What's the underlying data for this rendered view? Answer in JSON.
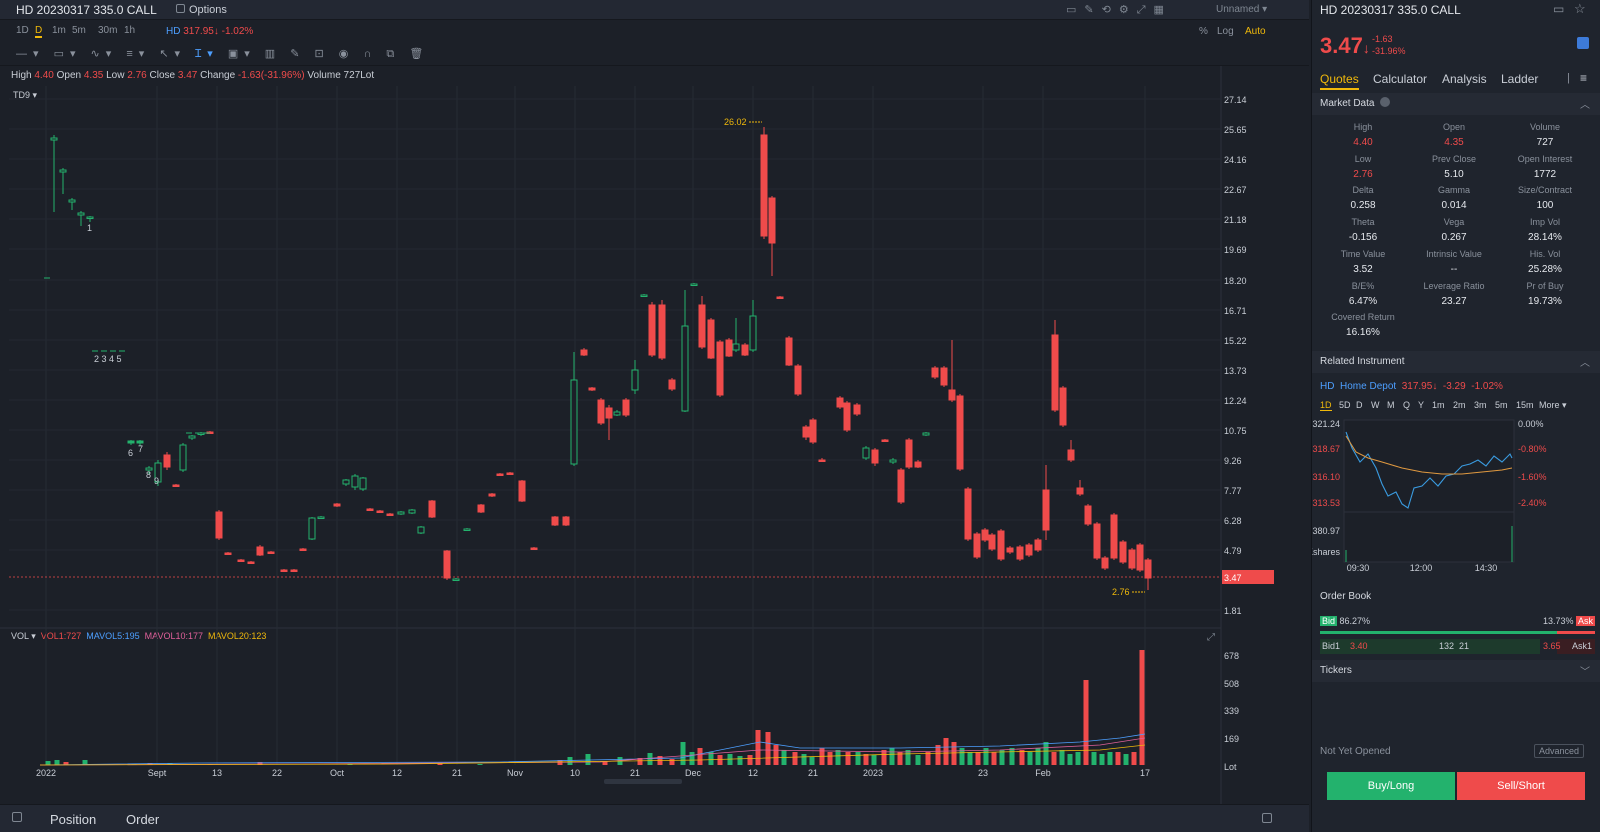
{
  "topbar": {
    "title": "HD 20230317 335.0 CALL",
    "options_label": "Options",
    "layout_label": "Unnamed"
  },
  "periods": [
    "1D",
    "D",
    "1m",
    "5m",
    "30m",
    "1h"
  ],
  "active_period": "D",
  "underlying_mini": {
    "symbol": "HD",
    "price": "317.95",
    "change": "-1.02%"
  },
  "scale_options": {
    "percent": "%",
    "log": "Log",
    "auto": "Auto"
  },
  "ohlc": {
    "high_label": "High",
    "high": "4.40",
    "open_label": "Open",
    "open": "4.35",
    "low_label": "Low",
    "low": "2.76",
    "close_label": "Close",
    "close": "3.47",
    "change_label": "Change",
    "change": "-1.63(-31.96%)",
    "volume_label": "Volume",
    "volume": "727Lot"
  },
  "indicator_label": "TD9",
  "vol_legend": {
    "vol": "VOL",
    "vol1": "VOL1:727",
    "mavol5": "MAVOL5:195",
    "mavol10": "MAVOL10:177",
    "mavol20": "MAVOL20:123"
  },
  "price_axis": [
    "27.14",
    "25.65",
    "24.16",
    "22.67",
    "21.18",
    "19.69",
    "18.20",
    "16.71",
    "15.22",
    "13.73",
    "12.24",
    "10.75",
    "9.26",
    "7.77",
    "6.28",
    "4.79",
    "3.47",
    "1.81"
  ],
  "vol_axis": [
    "678",
    "508",
    "339",
    "169",
    "Lot"
  ],
  "time_axis": [
    "2022",
    "Sept",
    "13",
    "22",
    "Oct",
    "12",
    "21",
    "Nov",
    "10",
    "21",
    "Dec",
    "12",
    "21",
    "2023",
    "23",
    "Feb",
    "17"
  ],
  "annotations": {
    "high_mark": "26.02",
    "low_mark": "2.76",
    "td_a": "1",
    "td_b": "2 3 4 5",
    "td_c": "6",
    "td_d": "7",
    "td_e": "8",
    "td_f": "9"
  },
  "colors": {
    "up": "#23b26d",
    "down": "#ef4b4b",
    "bg": "#1c2028",
    "accent": "#f0b90b"
  },
  "chart_data": {
    "type": "candlestick",
    "candles": [
      [
        54,
        140,
        138,
        212,
        135
      ],
      [
        63,
        172,
        170,
        194,
        168
      ],
      [
        72,
        202,
        200,
        210,
        198
      ],
      [
        81,
        215,
        213,
        226,
        211
      ],
      [
        90,
        218,
        217,
        222,
        216
      ],
      [
        131,
        443,
        441,
        445,
        440
      ],
      [
        140,
        443,
        441,
        446,
        440
      ],
      [
        149,
        470,
        468,
        474,
        466
      ],
      [
        158,
        482,
        463,
        486,
        460
      ],
      [
        167,
        455,
        467,
        470,
        452
      ],
      [
        176,
        485,
        486,
        487,
        484
      ],
      [
        183,
        470,
        445,
        472,
        443
      ],
      [
        192,
        438,
        436,
        440,
        435
      ],
      [
        201,
        434,
        433,
        436,
        432
      ],
      [
        210,
        432,
        432,
        433,
        431
      ],
      [
        219,
        512,
        538,
        540,
        510
      ],
      [
        228,
        553,
        554,
        555,
        552
      ],
      [
        241,
        560,
        561,
        562,
        559
      ],
      [
        251,
        562,
        563,
        564,
        561
      ],
      [
        260,
        547,
        555,
        556,
        545
      ],
      [
        271,
        552,
        553,
        554,
        551
      ],
      [
        284,
        570,
        570,
        571,
        569
      ],
      [
        294,
        570,
        570,
        571,
        569
      ],
      [
        303,
        549,
        550,
        551,
        548
      ],
      [
        312,
        539,
        518,
        540,
        517
      ],
      [
        321,
        518,
        517,
        519,
        516
      ],
      [
        337,
        504,
        506,
        507,
        503
      ],
      [
        346,
        484,
        480,
        486,
        479
      ],
      [
        355,
        487,
        476,
        490,
        474
      ],
      [
        363,
        489,
        478,
        491,
        477
      ],
      [
        370,
        509,
        510,
        511,
        508
      ],
      [
        380,
        511,
        512,
        513,
        510
      ],
      [
        390,
        514,
        515,
        516,
        513
      ],
      [
        401,
        514,
        512,
        515,
        511
      ],
      [
        412,
        513,
        510,
        514,
        509
      ],
      [
        421,
        533,
        527,
        534,
        526
      ],
      [
        432,
        501,
        517,
        518,
        500
      ],
      [
        447,
        551,
        578,
        580,
        550
      ],
      [
        456,
        580,
        579,
        581,
        578
      ],
      [
        467,
        530,
        529,
        531,
        528
      ],
      [
        481,
        505,
        512,
        513,
        504
      ],
      [
        492,
        494,
        496,
        497,
        493
      ],
      [
        500,
        474,
        474,
        476,
        473
      ],
      [
        510,
        473,
        474,
        475,
        472
      ],
      [
        522,
        481,
        501,
        502,
        480
      ],
      [
        534,
        548,
        549,
        550,
        547
      ],
      [
        555,
        517,
        525,
        526,
        516
      ],
      [
        566,
        517,
        525,
        526,
        516
      ],
      [
        574,
        464,
        380,
        466,
        352
      ],
      [
        584,
        350,
        355,
        356,
        348
      ],
      [
        592,
        388,
        390,
        391,
        387
      ],
      [
        601,
        400,
        423,
        425,
        398
      ],
      [
        609,
        408,
        418,
        440,
        405
      ],
      [
        617,
        415,
        412,
        416,
        410
      ],
      [
        626,
        400,
        415,
        417,
        398
      ],
      [
        635,
        390,
        370,
        394,
        360
      ],
      [
        644,
        296,
        295,
        297,
        294
      ],
      [
        652,
        305,
        355,
        357,
        302
      ],
      [
        662,
        305,
        358,
        360,
        300
      ],
      [
        672,
        380,
        389,
        391,
        378
      ],
      [
        685,
        411,
        326,
        412,
        290
      ],
      [
        694,
        285,
        284,
        286,
        283
      ],
      [
        702,
        305,
        347,
        349,
        296
      ],
      [
        711,
        320,
        358,
        359,
        318
      ],
      [
        720,
        342,
        395,
        397,
        340
      ],
      [
        729,
        340,
        356,
        357,
        338
      ],
      [
        736,
        350,
        344,
        352,
        318
      ],
      [
        745,
        345,
        355,
        356,
        343
      ],
      [
        753,
        350,
        316,
        352,
        300
      ],
      [
        764,
        135,
        236,
        239,
        127
      ],
      [
        772,
        198,
        243,
        276,
        196
      ],
      [
        780,
        297,
        298,
        299,
        296
      ],
      [
        789,
        338,
        365,
        366,
        336
      ],
      [
        798,
        366,
        394,
        396,
        364
      ],
      [
        806,
        427,
        437,
        440,
        425
      ],
      [
        813,
        420,
        442,
        444,
        418
      ],
      [
        822,
        460,
        460,
        462,
        458
      ],
      [
        840,
        398,
        407,
        409,
        396
      ],
      [
        847,
        403,
        430,
        432,
        401
      ],
      [
        857,
        405,
        414,
        416,
        403
      ],
      [
        866,
        458,
        448,
        460,
        446
      ],
      [
        875,
        450,
        463,
        466,
        448
      ],
      [
        885,
        440,
        441,
        442,
        439
      ],
      [
        893,
        462,
        460,
        464,
        458
      ],
      [
        901,
        470,
        502,
        504,
        468
      ],
      [
        909,
        440,
        467,
        469,
        438
      ],
      [
        918,
        462,
        467,
        468,
        460
      ],
      [
        926,
        435,
        433,
        436,
        432
      ],
      [
        935,
        368,
        377,
        379,
        366
      ],
      [
        944,
        368,
        385,
        387,
        366
      ],
      [
        952,
        390,
        400,
        402,
        340
      ],
      [
        960,
        396,
        469,
        471,
        394
      ],
      [
        968,
        489,
        539,
        541,
        487
      ],
      [
        977,
        534,
        557,
        559,
        532
      ],
      [
        985,
        530,
        540,
        542,
        528
      ],
      [
        992,
        535,
        549,
        551,
        533
      ],
      [
        1001,
        531,
        559,
        561,
        529
      ],
      [
        1010,
        548,
        552,
        554,
        546
      ],
      [
        1020,
        547,
        559,
        561,
        545
      ],
      [
        1029,
        545,
        555,
        557,
        543
      ],
      [
        1038,
        540,
        550,
        552,
        538
      ],
      [
        1046,
        490,
        530,
        540,
        465
      ],
      [
        1055,
        335,
        410,
        412,
        320
      ],
      [
        1063,
        388,
        425,
        427,
        386
      ],
      [
        1071,
        450,
        460,
        462,
        440
      ],
      [
        1080,
        488,
        494,
        496,
        480
      ],
      [
        1088,
        506,
        524,
        526,
        504
      ],
      [
        1097,
        524,
        558,
        560,
        522
      ],
      [
        1105,
        558,
        568,
        570,
        556
      ],
      [
        1114,
        515,
        558,
        560,
        513
      ],
      [
        1123,
        542,
        562,
        564,
        540
      ],
      [
        1132,
        550,
        568,
        570,
        548
      ],
      [
        1140,
        545,
        570,
        572,
        543
      ],
      [
        1148,
        560,
        578,
        590,
        558
      ]
    ],
    "volumes": [
      [
        48,
        761,
        "u"
      ],
      [
        57,
        760,
        "u"
      ],
      [
        66,
        762,
        "d"
      ],
      [
        85,
        760,
        "u"
      ],
      [
        134,
        764,
        "u"
      ],
      [
        150,
        763,
        "d"
      ],
      [
        170,
        763,
        "u"
      ],
      [
        210,
        764,
        "d"
      ],
      [
        260,
        762,
        "d"
      ],
      [
        350,
        764,
        "u"
      ],
      [
        440,
        763,
        "d"
      ],
      [
        480,
        764,
        "u"
      ],
      [
        560,
        760,
        "d"
      ],
      [
        570,
        757,
        "u"
      ],
      [
        588,
        754,
        "u"
      ],
      [
        605,
        761,
        "d"
      ],
      [
        620,
        757,
        "u"
      ],
      [
        640,
        758,
        "d"
      ],
      [
        650,
        753,
        "u"
      ],
      [
        660,
        756,
        "d"
      ],
      [
        672,
        759,
        "d"
      ],
      [
        683,
        742,
        "u"
      ],
      [
        692,
        752,
        "u"
      ],
      [
        700,
        748,
        "d"
      ],
      [
        711,
        752,
        "u"
      ],
      [
        720,
        755,
        "d"
      ],
      [
        730,
        754,
        "u"
      ],
      [
        740,
        756,
        "u"
      ],
      [
        750,
        755,
        "d"
      ],
      [
        758,
        730,
        "d"
      ],
      [
        768,
        732,
        "d"
      ],
      [
        776,
        745,
        "d"
      ],
      [
        784,
        750,
        "u"
      ],
      [
        795,
        752,
        "d"
      ],
      [
        804,
        754,
        "u"
      ],
      [
        812,
        757,
        "u"
      ],
      [
        822,
        748,
        "d"
      ],
      [
        830,
        752,
        "d"
      ],
      [
        838,
        750,
        "u"
      ],
      [
        848,
        752,
        "d"
      ],
      [
        858,
        752,
        "u"
      ],
      [
        866,
        754,
        "d"
      ],
      [
        874,
        755,
        "u"
      ],
      [
        884,
        750,
        "d"
      ],
      [
        892,
        748,
        "u"
      ],
      [
        900,
        752,
        "d"
      ],
      [
        908,
        750,
        "u"
      ],
      [
        918,
        755,
        "u"
      ],
      [
        928,
        752,
        "d"
      ],
      [
        938,
        745,
        "d"
      ],
      [
        946,
        738,
        "d"
      ],
      [
        954,
        742,
        "d"
      ],
      [
        962,
        748,
        "u"
      ],
      [
        970,
        752,
        "u"
      ],
      [
        978,
        752,
        "d"
      ],
      [
        986,
        748,
        "u"
      ],
      [
        994,
        752,
        "d"
      ],
      [
        1002,
        750,
        "u"
      ],
      [
        1012,
        748,
        "u"
      ],
      [
        1022,
        750,
        "d"
      ],
      [
        1030,
        752,
        "u"
      ],
      [
        1038,
        748,
        "u"
      ],
      [
        1046,
        742,
        "u"
      ],
      [
        1054,
        752,
        "d"
      ],
      [
        1062,
        750,
        "u"
      ],
      [
        1070,
        754,
        "u"
      ],
      [
        1078,
        752,
        "u"
      ],
      [
        1086,
        680,
        "d"
      ],
      [
        1094,
        752,
        "u"
      ],
      [
        1102,
        754,
        "u"
      ],
      [
        1110,
        752,
        "u"
      ],
      [
        1118,
        752,
        "d"
      ],
      [
        1126,
        754,
        "u"
      ],
      [
        1134,
        752,
        "d"
      ],
      [
        1142,
        650,
        "d"
      ]
    ]
  },
  "right": {
    "title": "HD 20230317 335.0 CALL",
    "price": "3.47",
    "change": "-1.63",
    "change_pct": "-31.96%",
    "tabs": [
      "Quotes",
      "Calculator",
      "Analysis",
      "Ladder"
    ],
    "market_data_title": "Market Data",
    "market_data": [
      {
        "label": "High",
        "value": "4.40",
        "color": "red"
      },
      {
        "label": "Open",
        "value": "4.35",
        "color": "red"
      },
      {
        "label": "Volume",
        "value": "727",
        "color": ""
      },
      {
        "label": "Low",
        "value": "2.76",
        "color": "red"
      },
      {
        "label": "Prev Close",
        "value": "5.10",
        "color": ""
      },
      {
        "label": "Open Interest",
        "value": "1772",
        "color": ""
      },
      {
        "label": "Delta",
        "value": "0.258",
        "color": ""
      },
      {
        "label": "Gamma",
        "value": "0.014",
        "color": ""
      },
      {
        "label": "Size/Contract",
        "value": "100",
        "color": ""
      },
      {
        "label": "Theta",
        "value": "-0.156",
        "color": ""
      },
      {
        "label": "Vega",
        "value": "0.267",
        "color": ""
      },
      {
        "label": "Imp Vol",
        "value": "28.14%",
        "color": ""
      },
      {
        "label": "Time Value",
        "value": "3.52",
        "color": ""
      },
      {
        "label": "Intrinsic Value",
        "value": "--",
        "color": ""
      },
      {
        "label": "His. Vol",
        "value": "25.28%",
        "color": ""
      },
      {
        "label": "B/E%",
        "value": "6.47%",
        "color": ""
      },
      {
        "label": "Leverage Ratio",
        "value": "23.27",
        "color": ""
      },
      {
        "label": "Pr of Buy",
        "value": "19.73%",
        "color": ""
      },
      {
        "label": "Covered Return",
        "value": "16.16%",
        "color": ""
      }
    ],
    "related_title": "Related Instrument",
    "related": {
      "symbol": "HD",
      "name": "Home Depot",
      "price": "317.95",
      "change": "-3.29",
      "change_pct": "-1.02%"
    },
    "mini_periods": [
      "1D",
      "5D",
      "D",
      "W",
      "M",
      "Q",
      "Y",
      "1m",
      "2m",
      "3m",
      "5m",
      "15m",
      "More"
    ],
    "mini_left_axis": [
      "321.24",
      "318.67",
      "316.10",
      "313.53",
      "380.97",
      "Kshares"
    ],
    "mini_right_axis": [
      "0.00%",
      "-0.80%",
      "-1.60%",
      "-2.40%"
    ],
    "mini_time": [
      "09:30",
      "12:00",
      "14:30"
    ],
    "order_book_title": "Order Book",
    "bid_label": "Bid",
    "bid_pct": "86.27%",
    "ask_label": "Ask",
    "ask_pct": "13.73%",
    "bid1_label": "Bid1",
    "bid1_price": "3.40",
    "bid1_size": "132",
    "ask1_size": "21",
    "ask1_price": "3.65",
    "ask1_label": "Ask1",
    "tickers_title": "Tickers",
    "status": "Not Yet Opened",
    "advanced": "Advanced",
    "buy": "Buy/Long",
    "sell": "Sell/Short"
  },
  "bottom": {
    "position": "Position",
    "order": "Order"
  }
}
